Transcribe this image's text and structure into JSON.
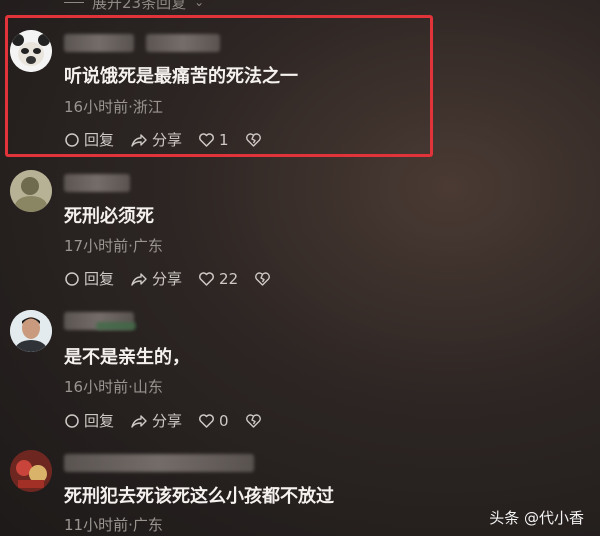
{
  "top": {
    "expand_label": "展开23条回复"
  },
  "comments": [
    {
      "text": "听说饿死是最痛苦的死法之一",
      "meta": "16小时前·浙江",
      "reply": "回复",
      "share": "分享",
      "likes": "1"
    },
    {
      "text": "死刑必须死",
      "meta": "17小时前·广东",
      "reply": "回复",
      "share": "分享",
      "likes": "22"
    },
    {
      "text": "是不是亲生的，",
      "meta": "16小时前·山东",
      "reply": "回复",
      "share": "分享",
      "likes": "0"
    },
    {
      "text": "死刑犯去死该死这么小孩都不放过",
      "meta": "11小时前·广东"
    }
  ],
  "watermark": {
    "label": "头条 @代小香"
  },
  "colors": {
    "highlight": "#e0343a",
    "text": "#f4f1ef",
    "meta": "#9b9591"
  }
}
